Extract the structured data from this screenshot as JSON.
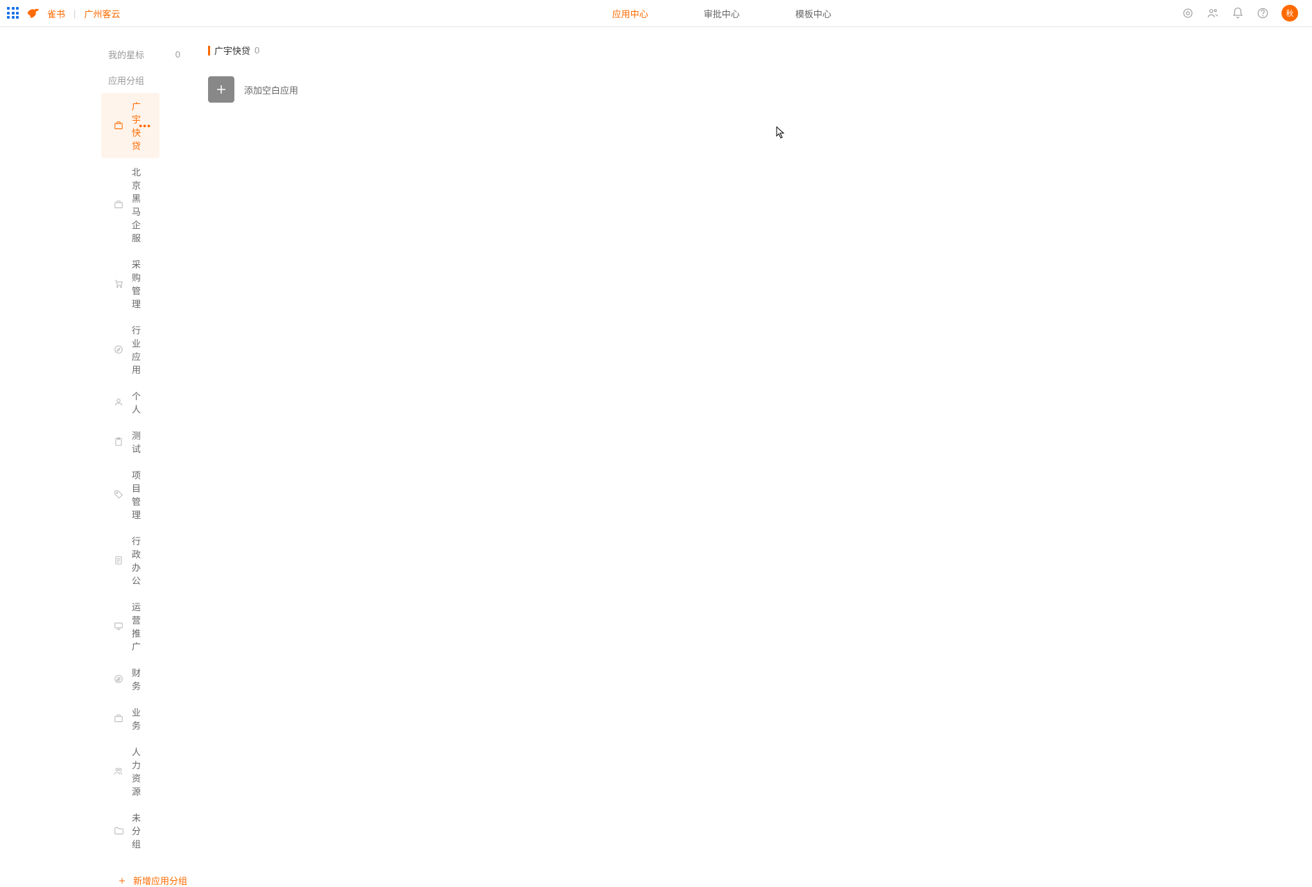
{
  "header": {
    "brand_name": "雀书",
    "org_name": "广州客云",
    "nav": [
      {
        "label": "应用中心",
        "active": true
      },
      {
        "label": "审批中心",
        "active": false
      },
      {
        "label": "模板中心",
        "active": false
      }
    ],
    "avatar_text": "秋"
  },
  "sidebar": {
    "star_label": "我的星标",
    "star_count": "0",
    "group_header": "应用分组",
    "groups": [
      {
        "icon": "briefcase",
        "label": "广宇快贷",
        "active": true
      },
      {
        "icon": "briefcase",
        "label": "北京黑马企服",
        "active": false
      },
      {
        "icon": "cart",
        "label": "采购管理",
        "active": false
      },
      {
        "icon": "compass",
        "label": "行业应用",
        "active": false
      },
      {
        "icon": "user",
        "label": "个人",
        "active": false
      },
      {
        "icon": "clipboard",
        "label": "测试",
        "active": false
      },
      {
        "icon": "tag",
        "label": "项目管理",
        "active": false
      },
      {
        "icon": "document",
        "label": "行政办公",
        "active": false
      },
      {
        "icon": "monitor",
        "label": "运营推广",
        "active": false
      },
      {
        "icon": "coin",
        "label": "财务",
        "active": false
      },
      {
        "icon": "briefcase",
        "label": "业务",
        "active": false
      },
      {
        "icon": "people",
        "label": "人力资源",
        "active": false
      },
      {
        "icon": "folder",
        "label": "未分组",
        "active": false
      }
    ],
    "add_group_label": "新增应用分组"
  },
  "content": {
    "title": "广宇快贷",
    "count": "0",
    "add_blank_label": "添加空白应用"
  }
}
